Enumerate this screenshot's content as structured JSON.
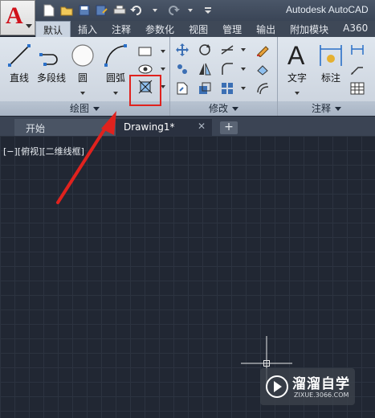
{
  "app": {
    "logo_letter": "A",
    "title": "Autodesk AutoCAD"
  },
  "ribbon_tabs": [
    "默认",
    "插入",
    "注释",
    "参数化",
    "视图",
    "管理",
    "输出",
    "附加模块",
    "A360"
  ],
  "draw_panel": {
    "title": "绘图",
    "tools": {
      "line": "直线",
      "polyline": "多段线",
      "circle": "圆",
      "arc": "圆弧"
    }
  },
  "modify_panel": {
    "title": "修改"
  },
  "annotation_panel": {
    "title": "注释",
    "tools": {
      "text": "文字",
      "dimension": "标注"
    }
  },
  "file_tabs": {
    "start": "开始",
    "drawing": "Drawing1*",
    "close": "✕",
    "add": "+"
  },
  "viewport": {
    "label": "[−][俯视][二维线框]"
  },
  "watermark": {
    "name": "溜溜自学",
    "url": "ZIXUE.3066.COM"
  },
  "colors": {
    "highlight": "#e0221e",
    "canvas": "#212733",
    "arrow": "#e0221e"
  }
}
